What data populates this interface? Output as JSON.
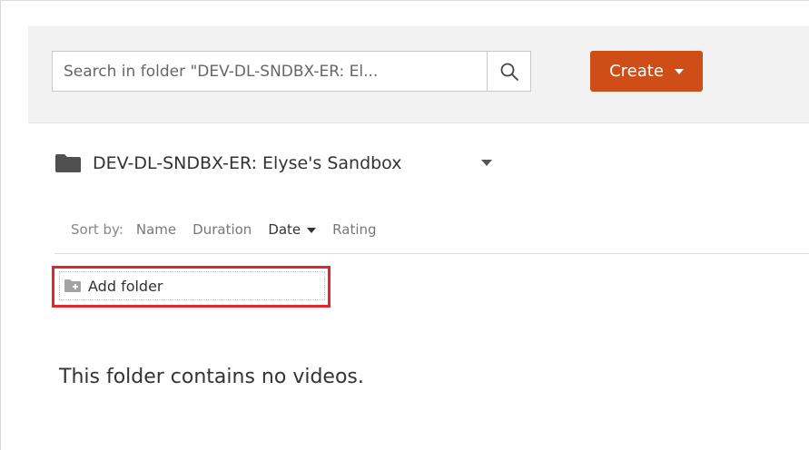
{
  "toolbar": {
    "search_placeholder": "Search in folder \"DEV-DL-SNDBX-ER: El...",
    "search_icon": "search-icon",
    "create_label": "Create",
    "create_color": "#cf4e17"
  },
  "folder": {
    "icon": "folder-icon",
    "title": "DEV-DL-SNDBX-ER: Elyse's Sandbox"
  },
  "sort": {
    "label": "Sort by:",
    "options": [
      {
        "label": "Name",
        "active": false
      },
      {
        "label": "Duration",
        "active": false
      },
      {
        "label": "Date",
        "active": true
      },
      {
        "label": "Rating",
        "active": false
      }
    ]
  },
  "add_folder": {
    "icon": "add-folder-icon",
    "label": "Add folder",
    "highlight_color": "#e3262e"
  },
  "empty_message": "This folder contains no videos."
}
